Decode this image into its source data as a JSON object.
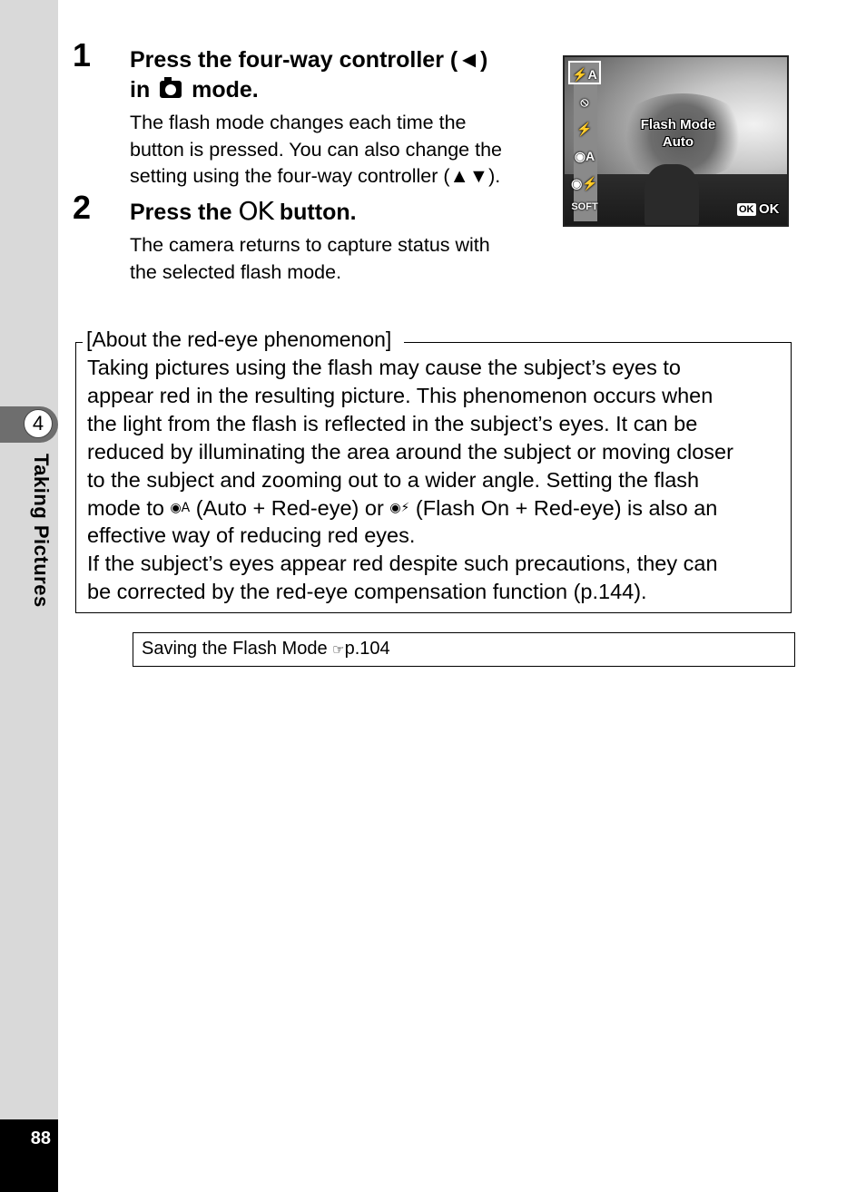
{
  "sidebar": {
    "chapter_number": "4",
    "chapter_title": "Taking Pictures",
    "page_number": "88",
    "colors": {
      "sidebar_bg": "#d9d9d9",
      "tab_bg": "#6e6e6e",
      "page_box": "#000000"
    }
  },
  "steps": [
    {
      "number": "1",
      "title_line1": "Press the four-way controller (◄)",
      "title_line2_prefix": "in",
      "title_line2_icon": "camera-icon",
      "title_line2_suffix": "mode.",
      "body": [
        "The flash mode changes each time the",
        "button is pressed. You can also change the",
        "setting using the four-way controller (▲▼)."
      ]
    },
    {
      "number": "2",
      "title_prefix": "Press the",
      "title_ok": "OK",
      "title_suffix": "button.",
      "body": [
        "The camera returns to capture status with",
        "the selected flash mode."
      ]
    }
  ],
  "camera_screen": {
    "menu_items": [
      {
        "icon": "flash-auto-icon",
        "glyph": "⚡A",
        "selected": true
      },
      {
        "icon": "flash-off-icon",
        "glyph": "⦸",
        "selected": false
      },
      {
        "icon": "flash-on-icon",
        "glyph": "⚡",
        "selected": false
      },
      {
        "icon": "auto-red-eye-icon",
        "glyph": "◉A",
        "selected": false
      },
      {
        "icon": "flash-on-red-eye-icon",
        "glyph": "◉⚡",
        "selected": false
      },
      {
        "icon": "soft-flash-icon",
        "glyph": "SOFT",
        "selected": false
      }
    ],
    "overlay_line1": "Flash Mode",
    "overlay_line2": "Auto",
    "ok_badge": "OK",
    "ok_label": "OK"
  },
  "note": {
    "title": "[About the red-eye phenomenon]",
    "lines": [
      "Taking pictures using the flash may cause the subject’s eyes to",
      "appear red in the resulting picture. This phenomenon occurs when",
      "the light from the flash is reflected in the subject’s eyes. It can be",
      "reduced by illuminating the area around the subject or moving closer",
      "to the subject and zooming out to a wider angle. Setting the flash"
    ],
    "line6_a": "mode to",
    "line6_sym1": "◉A",
    "line6_b": "(Auto + Red-eye) or",
    "line6_sym2": "◉⚡",
    "line6_c": "(Flash On + Red-eye) is also an",
    "lines_after": [
      "effective way of reducing red eyes.",
      "If the subject’s eyes appear red despite such precautions, they can",
      "be corrected by the red-eye compensation function (p.144)."
    ]
  },
  "reference": {
    "text": "Saving the Flash Mode",
    "icon": "☞",
    "page": "p.104"
  }
}
